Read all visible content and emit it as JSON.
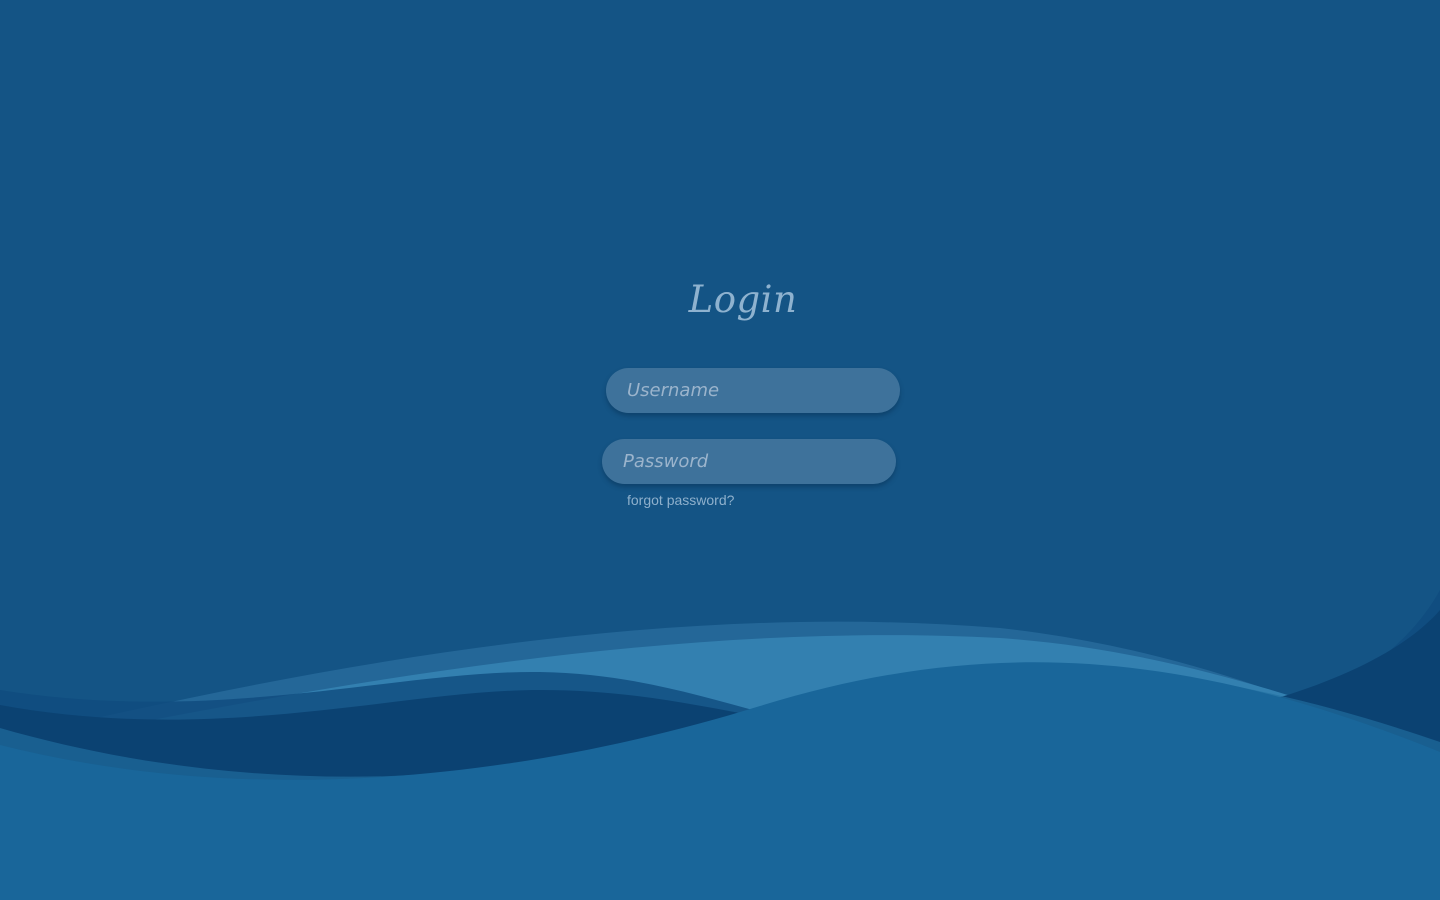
{
  "login": {
    "title": "Login",
    "username": {
      "value": "",
      "placeholder": "Username"
    },
    "password": {
      "value": "",
      "placeholder": "Password"
    },
    "forgot_password": "forgot password?"
  },
  "theme": {
    "background": "#145485",
    "wave_light": "#3380b0",
    "wave_dark": "#0b4272",
    "wave_bottom": "#19669a",
    "text": "#8eb2cf"
  }
}
